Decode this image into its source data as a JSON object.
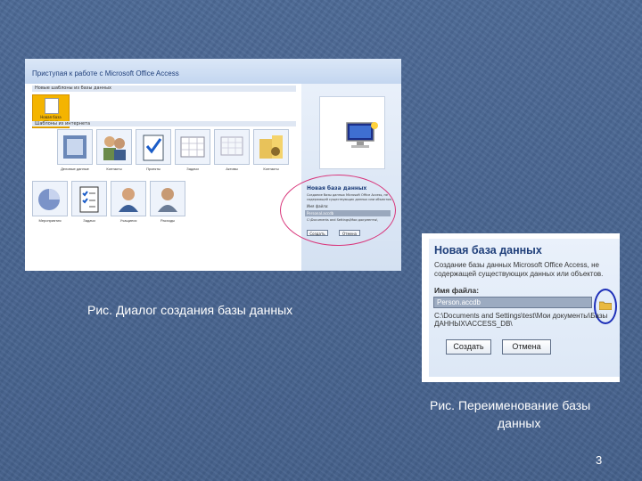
{
  "slide": {
    "caption_left": "Рис. Диалог создания базы данных",
    "caption_right_line1": "Рис. Переименование базы",
    "caption_right_line2": "данных",
    "page_number": "3"
  },
  "screenshot1": {
    "title": "Приступая к работе с Microsoft Office Access",
    "section_featured": "Новые шаблоны из базы данных",
    "featured_label": "Новая база данных",
    "section_templates": "Шаблоны из интернета",
    "templates": [
      "Деловые данные",
      "Контакты",
      "Проекты",
      "Задачи",
      "Активы",
      "Контакты",
      "Мероприятия",
      "Задачи",
      "Учащиеся",
      "Расходы"
    ],
    "right_title": "Новая база данных",
    "right_desc": "Создание базы данных Microsoft Office Access, не содержащей существующих данных или объектов.",
    "right_label": "Имя файла:",
    "right_input": "Personal.accdb",
    "right_path": "C:\\Documents and Settings\\Мои документы\\",
    "right_create": "Создать",
    "right_cancel": "Отмена"
  },
  "screenshot2": {
    "title": "Новая база данных",
    "desc": "Создание базы данных Microsoft Office Access, не содержащей существующих данных или объектов.",
    "label": "Имя файла:",
    "input_value": "Person.accdb",
    "path": "C:\\Documents and Settings\\test\\Мои документы\\Базы ДАННЫХ\\ACCESS_DB\\",
    "create_label": "Создать",
    "cancel_label": "Отмена"
  }
}
